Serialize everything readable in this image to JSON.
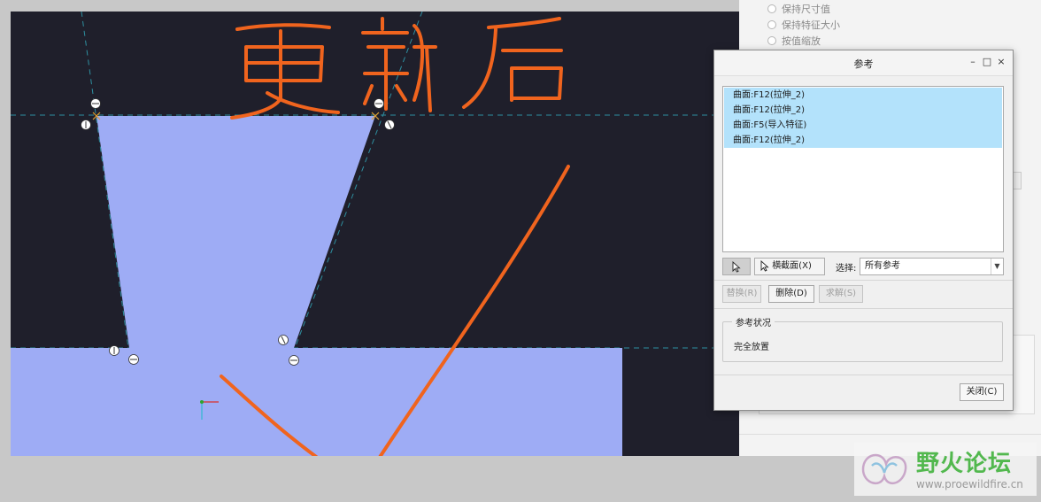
{
  "background_panel": {
    "options": [
      "保持尺寸值",
      "保持特征大小",
      "按值缩放"
    ]
  },
  "dialog": {
    "title": "参考",
    "window_buttons": {
      "minimize": "–",
      "maximize": "□",
      "close": "×"
    },
    "references": [
      "曲面:F12(拉伸_2)",
      "曲面:F12(拉伸_2)",
      "曲面:F5(导入特征)",
      "曲面:F12(拉伸_2)"
    ],
    "toolbar": {
      "cross_section_label": "横截面(X)",
      "select_label": "选择:",
      "select_value": "所有参考"
    },
    "actions": {
      "replace_label": "替换(R)",
      "delete_label": "删除(D)",
      "solve_label": "求解(S)"
    },
    "status": {
      "legend": "参考状况",
      "value": "完全放置"
    },
    "close_label": "关闭(C)"
  },
  "annotation": {
    "handwriting": "更新后",
    "color": "#f0641e"
  },
  "viewport": {
    "background": "#1f1f2b",
    "shape_color": "#9eacf5"
  },
  "watermark": {
    "title": "野火论坛",
    "url": "www.proewildfire.cn"
  }
}
